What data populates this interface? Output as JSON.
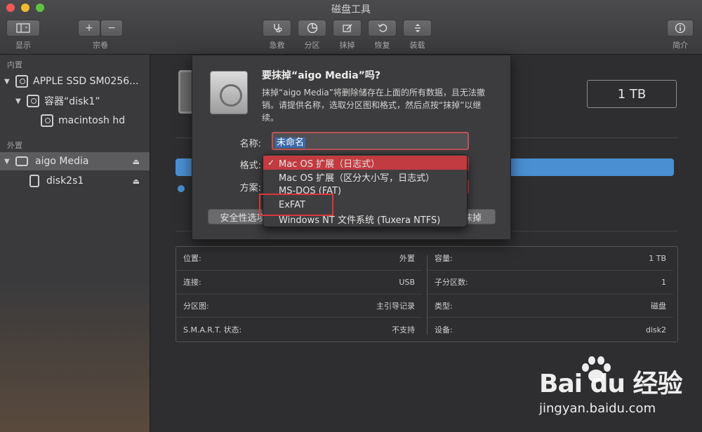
{
  "window": {
    "title": "磁盘工具"
  },
  "toolbar": {
    "display_label": "显示",
    "volume_label": "宗卷",
    "add_glyph": "+",
    "remove_glyph": "−",
    "actions": [
      {
        "label": "急救",
        "icon": "stethoscope-icon"
      },
      {
        "label": "分区",
        "icon": "pie-partition-icon"
      },
      {
        "label": "抹掉",
        "icon": "erase-icon"
      },
      {
        "label": "恢复",
        "icon": "restore-icon"
      },
      {
        "label": "装载",
        "icon": "mount-icon"
      }
    ],
    "info_label": "简介"
  },
  "sidebar": {
    "internal_header": "内置",
    "external_header": "外置",
    "items": [
      {
        "label": "APPLE SSD SM0256...",
        "level": 0
      },
      {
        "label": "容器“disk1”",
        "level": 1
      },
      {
        "label": "macintosh hd",
        "level": 2
      },
      {
        "label": "aigo Media",
        "level": 0,
        "selected": true
      },
      {
        "label": "disk2s1",
        "level": 1
      }
    ]
  },
  "main": {
    "capacity_box": "1 TB",
    "info": {
      "left": [
        {
          "k": "位置:",
          "v": "外置"
        },
        {
          "k": "连接:",
          "v": "USB"
        },
        {
          "k": "分区图:",
          "v": "主引导记录"
        },
        {
          "k": "S.M.A.R.T. 状态:",
          "v": "不支持"
        }
      ],
      "right": [
        {
          "k": "容量:",
          "v": "1 TB"
        },
        {
          "k": "子分区数:",
          "v": "1"
        },
        {
          "k": "类型:",
          "v": "磁盘"
        },
        {
          "k": "设备:",
          "v": "disk2"
        }
      ]
    }
  },
  "dialog": {
    "title": "要抹掉“aigo Media”吗?",
    "message": "抹掉“aigo Media”将删除储存在上面的所有数据，且无法撤销。请提供名称，选取分区图和格式，然后点按“抹掉”以继续。",
    "name_label": "名称:",
    "name_value": "未命名",
    "format_label": "格式:",
    "scheme_label": "方案:",
    "security_button": "安全性选项",
    "erase_button": "抹掉"
  },
  "format_menu": {
    "options": [
      "Mac OS 扩展（日志式）",
      "Mac OS 扩展（区分大小写，日志式）",
      "MS-DOS (FAT)",
      "ExFAT",
      "Windows NT 文件系统 (Tuxera NTFS)"
    ],
    "selected_index": 0,
    "check_glyph": "✓"
  },
  "watermark": {
    "brand": "Bai du 经验",
    "url": "jingyan.baidu.com"
  },
  "colors": {
    "accent_red": "#c23b40",
    "usage_blue": "#4a8fd1"
  }
}
